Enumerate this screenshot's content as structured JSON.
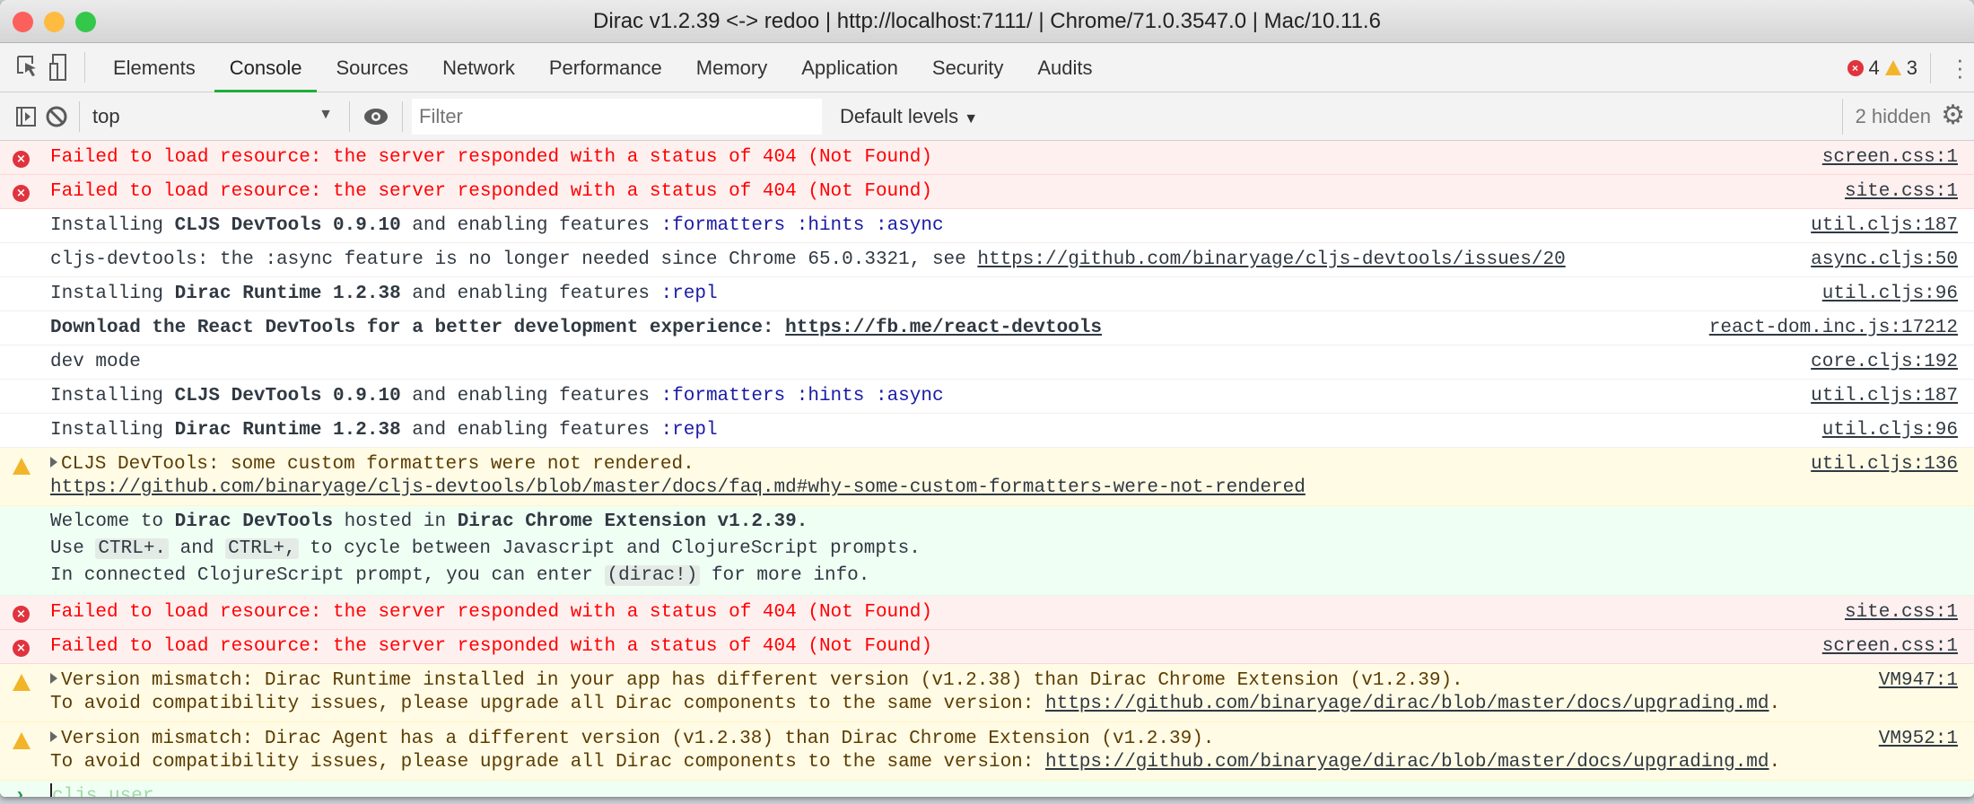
{
  "window": {
    "title": "Dirac v1.2.39 <-> redoo | http://localhost:7111/ | Chrome/71.0.3547.0 | Mac/10.11.6"
  },
  "tabs": [
    "Elements",
    "Console",
    "Sources",
    "Network",
    "Performance",
    "Memory",
    "Application",
    "Security",
    "Audits"
  ],
  "active_tab": "Console",
  "counts": {
    "errors": "4",
    "warnings": "3"
  },
  "toolbar": {
    "context": "top",
    "filter_placeholder": "Filter",
    "levels": "Default levels",
    "hidden": "2 hidden"
  },
  "colors": {
    "error": "#ff0000",
    "warning_bg": "#fffbe5",
    "error_bg": "#fff0f0",
    "accent": "#1fad3a"
  },
  "messages": [
    {
      "level": "error",
      "source": "screen.css:1",
      "lines": [
        [
          {
            "t": "Failed to load resource: the server responded with a status of 404 (Not Found)"
          }
        ]
      ]
    },
    {
      "level": "error",
      "source": "site.css:1",
      "lines": [
        [
          {
            "t": "Failed to load resource: the server responded with a status of 404 (Not Found)"
          }
        ]
      ]
    },
    {
      "level": "info",
      "source": "util.cljs:187",
      "lines": [
        [
          {
            "t": "Installing "
          },
          {
            "t": "CLJS DevTools 0.9.10",
            "s": "b"
          },
          {
            "t": " and enabling features "
          },
          {
            "t": ":formatters :hints :async",
            "s": "kw"
          }
        ]
      ]
    },
    {
      "level": "info",
      "source": "async.cljs:50",
      "lines": [
        [
          {
            "t": "cljs-devtools: the :async feature is no longer needed since Chrome 65.0.3321, see "
          },
          {
            "t": "https://github.com/binaryage/cljs-devtools/issues/20",
            "s": "lnk"
          }
        ]
      ]
    },
    {
      "level": "info",
      "source": "util.cljs:96",
      "lines": [
        [
          {
            "t": "Installing "
          },
          {
            "t": "Dirac Runtime 1.2.38",
            "s": "b"
          },
          {
            "t": " and enabling features "
          },
          {
            "t": ":repl",
            "s": "kw"
          }
        ]
      ]
    },
    {
      "level": "info",
      "source": "react-dom.inc.js:17212",
      "lines": [
        [
          {
            "t": "Download the React DevTools for a better development experience: ",
            "s": "b"
          },
          {
            "t": "https://fb.me/react-devtools",
            "s": "b lnk"
          }
        ]
      ]
    },
    {
      "level": "info",
      "source": "core.cljs:192",
      "lines": [
        [
          {
            "t": "dev mode"
          }
        ]
      ]
    },
    {
      "level": "info",
      "source": "util.cljs:187",
      "lines": [
        [
          {
            "t": "Installing "
          },
          {
            "t": "CLJS DevTools 0.9.10",
            "s": "b"
          },
          {
            "t": " and enabling features "
          },
          {
            "t": ":formatters :hints :async",
            "s": "kw"
          }
        ]
      ]
    },
    {
      "level": "info",
      "source": "util.cljs:96",
      "lines": [
        [
          {
            "t": "Installing "
          },
          {
            "t": "Dirac Runtime 1.2.38",
            "s": "b"
          },
          {
            "t": " and enabling features "
          },
          {
            "t": ":repl",
            "s": "kw"
          }
        ]
      ]
    },
    {
      "level": "warning",
      "expandable": true,
      "source": "util.cljs:136",
      "lines": [
        [
          {
            "t": "CLJS DevTools: some custom formatters were not rendered."
          }
        ],
        [
          {
            "t": "https://github.com/binaryage/cljs-devtools/blob/master/docs/faq.md#why-some-custom-formatters-were-not-rendered",
            "s": "lnk"
          }
        ]
      ]
    },
    {
      "level": "dirac",
      "source": "",
      "lines": [
        [
          {
            "t": "Welcome to "
          },
          {
            "t": "Dirac DevTools",
            "s": "b"
          },
          {
            "t": " hosted in "
          },
          {
            "t": "Dirac Chrome Extension v1.2.39.",
            "s": "b"
          }
        ],
        [
          {
            "t": "Use "
          },
          {
            "t": "CTRL+.",
            "s": "code"
          },
          {
            "t": " and "
          },
          {
            "t": "CTRL+,",
            "s": "code"
          },
          {
            "t": " to cycle between Javascript and ClojureScript prompts."
          }
        ],
        [
          {
            "t": "In connected ClojureScript prompt, you can enter "
          },
          {
            "t": "(dirac!)",
            "s": "code"
          },
          {
            "t": " for more info."
          }
        ]
      ]
    },
    {
      "level": "error",
      "source": "site.css:1",
      "lines": [
        [
          {
            "t": "Failed to load resource: the server responded with a status of 404 (Not Found)"
          }
        ]
      ]
    },
    {
      "level": "error",
      "source": "screen.css:1",
      "lines": [
        [
          {
            "t": "Failed to load resource: the server responded with a status of 404 (Not Found)"
          }
        ]
      ]
    },
    {
      "level": "warning",
      "expandable": true,
      "source": "VM947:1",
      "lines": [
        [
          {
            "t": "Version mismatch: Dirac Runtime installed in your app has different version (v1.2.38) than Dirac Chrome Extension (v1.2.39)."
          }
        ],
        [
          {
            "t": "To avoid compatibility issues, please upgrade all Dirac components to the same version: "
          },
          {
            "t": "https://github.com/binaryage/dirac/blob/master/docs/upgrading.md",
            "s": "lnk"
          },
          {
            "t": "."
          }
        ]
      ]
    },
    {
      "level": "warning",
      "expandable": true,
      "source": "VM952:1",
      "lines": [
        [
          {
            "t": "Version mismatch: Dirac Agent has a different version (v1.2.38) than Dirac Chrome Extension (v1.2.39)."
          }
        ],
        [
          {
            "t": "To avoid compatibility issues, please upgrade all Dirac components to the same version: "
          },
          {
            "t": "https://github.com/binaryage/dirac/blob/master/docs/upgrading.md",
            "s": "lnk"
          },
          {
            "t": "."
          }
        ]
      ]
    }
  ],
  "prompt": {
    "placeholder": "cljs.user"
  }
}
